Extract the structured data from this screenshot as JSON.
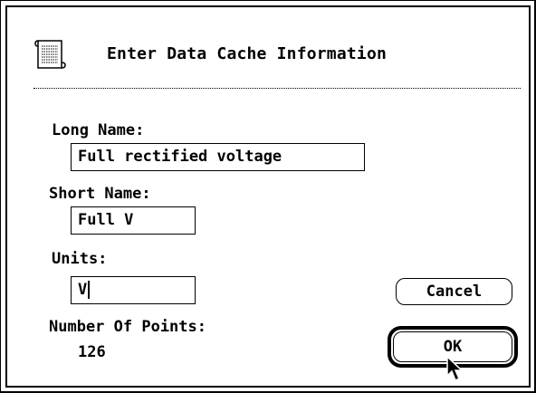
{
  "dialog": {
    "title": "Enter Data Cache Information",
    "icon": "scroll-icon"
  },
  "fields": {
    "long_name": {
      "label": "Long Name:",
      "value": "Full rectified voltage"
    },
    "short_name": {
      "label": "Short Name:",
      "value": "Full V"
    },
    "units": {
      "label": "Units:",
      "value": "V"
    }
  },
  "points": {
    "label": "Number Of Points:",
    "value": "126"
  },
  "buttons": {
    "cancel": "Cancel",
    "ok": "OK"
  }
}
